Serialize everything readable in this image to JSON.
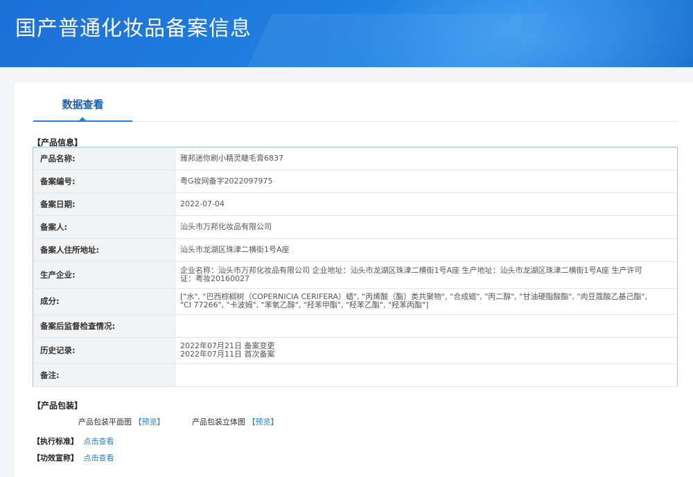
{
  "header": {
    "title": "国产普通化妆品备案信息"
  },
  "tabs": [
    {
      "label": "数据查看"
    }
  ],
  "product_info": {
    "section_label": "【产品信息】",
    "rows": [
      {
        "key": "产品名称:",
        "value": "雅邦迷你刷小精灵睫毛膏6837"
      },
      {
        "key": "备案编号:",
        "value": "粤G妆网备字2022097975"
      },
      {
        "key": "备案日期:",
        "value": "2022-07-04"
      },
      {
        "key": "备案人:",
        "value": "汕头市万邦化妆品有限公司"
      },
      {
        "key": "备案人住所地址:",
        "value": "汕头市龙湖区珠津二横街1号A座"
      },
      {
        "key": "生产企业:",
        "value": "企业名称：汕头市万邦化妆品有限公司 企业地址：汕头市龙湖区珠津二横街1号A座 生产地址：汕头市龙湖区珠津二横街1号A座 生产许可证：粤妆20160027"
      },
      {
        "key": "成分:",
        "value": "[\"水\", \"巴西棕榈树（COPERNICIA CERIFERA）蜡\", \"丙烯酸（酯）类共聚物\", \"合成蜡\", \"丙二醇\", \"甘油硬脂酸酯\", \"肉豆蔻酸乙基己酯\", \"CI 77266\", \"卡波姆\", \"苯氧乙醇\", \"羟苯甲酯\", \"羟苯乙酯\", \"羟苯丙酯\"]"
      },
      {
        "key": "备案后监督检查情况:",
        "value": ""
      },
      {
        "key": "历史记录:",
        "value": "2022年07月21日 备案变更",
        "value2": "2022年07月11日 首次备案"
      },
      {
        "key": "备注:",
        "value": ""
      }
    ]
  },
  "packaging": {
    "section_label": "【产品包装】",
    "flat_label": "产品包装平面图",
    "flat_link": "【预览】",
    "solid_label": "产品包装立体图",
    "solid_link": "【预览】"
  },
  "standard": {
    "label": "【执行标准】",
    "link": "点击查看"
  },
  "efficacy": {
    "label": "【功效宣称】",
    "link": "点击查看"
  }
}
